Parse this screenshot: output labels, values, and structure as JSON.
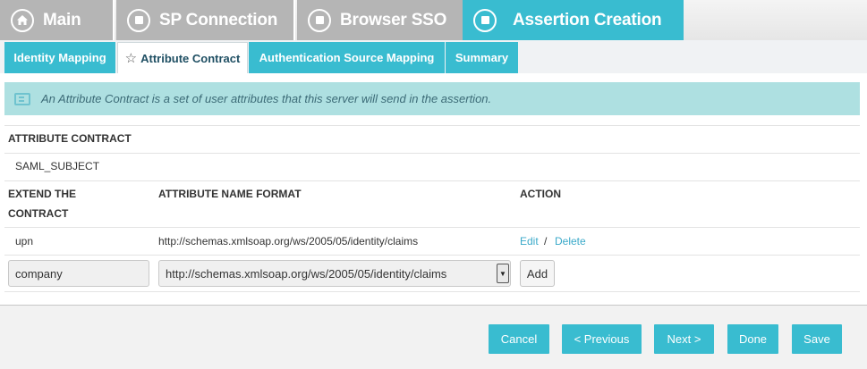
{
  "top_tabs": [
    {
      "label": "Main",
      "icon": "home-icon",
      "state": "inactive"
    },
    {
      "label": "SP Connection",
      "icon": "circle-square-icon",
      "state": "inactive"
    },
    {
      "label": "Browser SSO",
      "icon": "circle-square-icon",
      "state": "inactive"
    },
    {
      "label": "Assertion Creation",
      "icon": "circle-square-icon",
      "state": "active"
    }
  ],
  "sub_tabs": [
    {
      "label": "Identity Mapping",
      "active": false
    },
    {
      "label": "Attribute Contract",
      "active": true,
      "icon": "star-icon"
    },
    {
      "label": "Authentication Source Mapping",
      "active": false
    },
    {
      "label": "Summary",
      "active": false
    }
  ],
  "info": {
    "text": "An Attribute Contract is a set of user attributes that this server will send in the assertion."
  },
  "contract": {
    "heading": "ATTRIBUTE CONTRACT",
    "subject": "SAML_SUBJECT",
    "col_extend": "EXTEND THE CONTRACT",
    "col_format": "ATTRIBUTE NAME FORMAT",
    "col_action": "ACTION",
    "rows": [
      {
        "name": "upn",
        "format": "http://schemas.xmlsoap.org/ws/2005/05/identity/claims",
        "edit": "Edit",
        "sep": "/",
        "delete": "Delete"
      }
    ],
    "new_row": {
      "name_value": "company",
      "format_value": "http://schemas.xmlsoap.org/ws/2005/05/identity/claims",
      "add_label": "Add"
    }
  },
  "footer": {
    "cancel": "Cancel",
    "previous": "< Previous",
    "next": "Next >",
    "done": "Done",
    "save": "Save"
  },
  "colors": {
    "accent": "#39bcd0",
    "inactive_tab": "#b5b5b5",
    "info_bg": "#aee0e1",
    "link": "#3aa9c9"
  }
}
